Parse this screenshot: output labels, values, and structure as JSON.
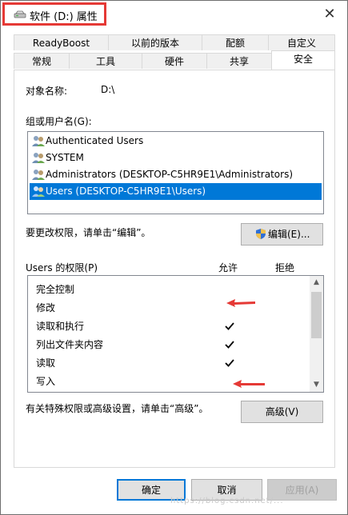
{
  "window": {
    "title": "软件 (D:) 属性",
    "close_glyph": "✕"
  },
  "tabs": {
    "row1": [
      {
        "label": "ReadyBoost"
      },
      {
        "label": "以前的版本"
      },
      {
        "label": "配额"
      },
      {
        "label": "自定义"
      }
    ],
    "row2": [
      {
        "label": "常规"
      },
      {
        "label": "工具"
      },
      {
        "label": "硬件"
      },
      {
        "label": "共享"
      },
      {
        "label": "安全",
        "active": true
      }
    ]
  },
  "object": {
    "label": "对象名称:",
    "value": "D:\\"
  },
  "groups": {
    "label": "组或用户名(G):",
    "items": [
      {
        "label": "Authenticated Users"
      },
      {
        "label": "SYSTEM"
      },
      {
        "label": "Administrators (DESKTOP-C5HR9E1\\Administrators)"
      },
      {
        "label": "Users (DESKTOP-C5HR9E1\\Users)",
        "selected": true
      }
    ]
  },
  "edit": {
    "hint": "要更改权限，请单击“编辑”。",
    "button": "编辑(E)..."
  },
  "permissions": {
    "header": "Users 的权限(P)",
    "allow": "允许",
    "deny": "拒绝",
    "rows": [
      {
        "label": "完全控制",
        "allow": false
      },
      {
        "label": "修改",
        "allow": false
      },
      {
        "label": "读取和执行",
        "allow": true
      },
      {
        "label": "列出文件夹内容",
        "allow": true
      },
      {
        "label": "读取",
        "allow": true
      },
      {
        "label": "写入",
        "allow": false
      }
    ]
  },
  "advanced": {
    "hint": "有关特殊权限或高级设置，请单击“高级”。",
    "button": "高级(V)"
  },
  "footer": {
    "ok": "确定",
    "cancel": "取消",
    "apply": "应用(A)"
  },
  "watermark": "https://blog.csdn.net/...",
  "colors": {
    "accent": "#0078d7",
    "annotation_red": "#e53935"
  }
}
